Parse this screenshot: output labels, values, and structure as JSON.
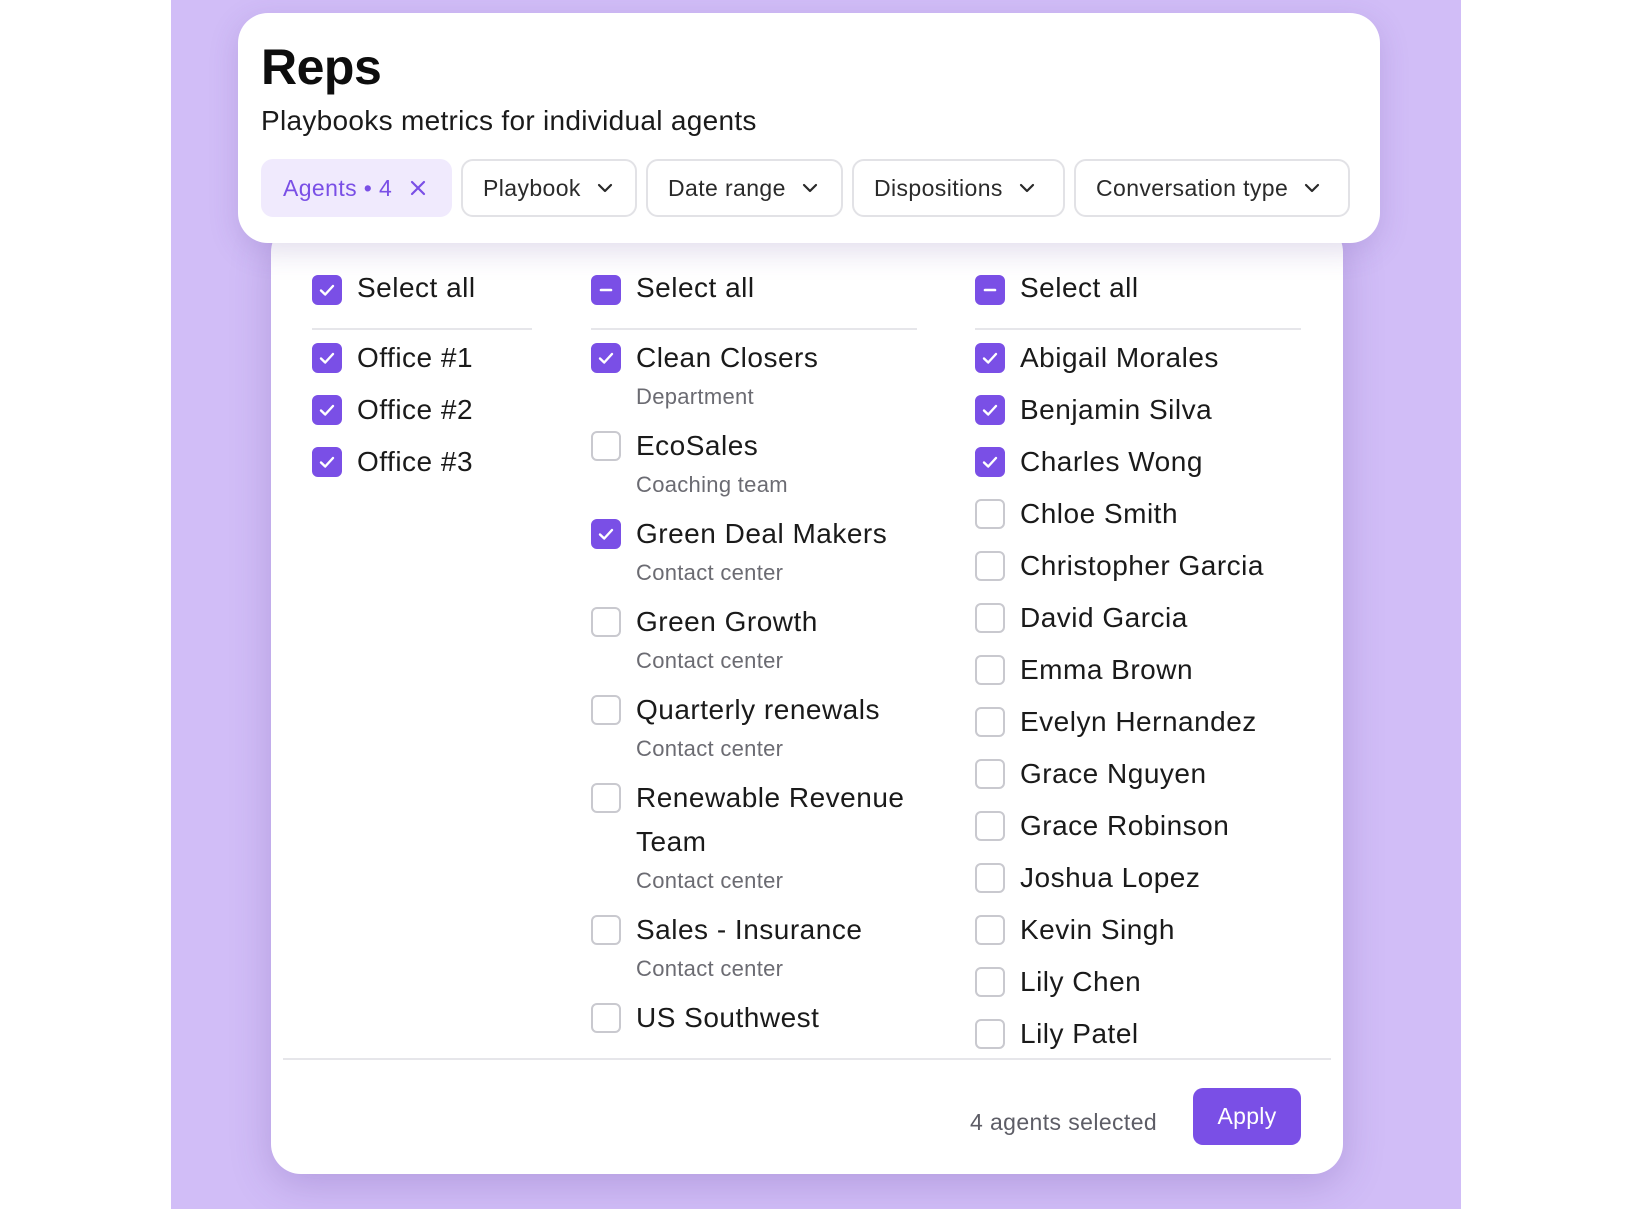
{
  "header": {
    "title": "Reps",
    "subtitle": "Playbooks metrics for individual agents",
    "filters": {
      "agents_label": "Agents • 4",
      "playbook_label": "Playbook",
      "date_range_label": "Date range",
      "dispositions_label": "Dispositions",
      "conversation_type_label": "Conversation type"
    }
  },
  "colors": {
    "accent": "#7a4fe6",
    "background": "#d1bdf7"
  },
  "offices": {
    "select_all": {
      "label": "Select all",
      "state": "checked"
    },
    "items": [
      {
        "label": "Office #1",
        "checked": true
      },
      {
        "label": "Office #2",
        "checked": true
      },
      {
        "label": "Office #3",
        "checked": true
      }
    ]
  },
  "teams": {
    "select_all": {
      "label": "Select all",
      "state": "partial"
    },
    "items": [
      {
        "label": "Clean Closers",
        "sub": "Department",
        "checked": true
      },
      {
        "label": "EcoSales",
        "sub": "Coaching team",
        "checked": false
      },
      {
        "label": "Green Deal Makers",
        "sub": "Contact center",
        "checked": true
      },
      {
        "label": "Green Growth",
        "sub": "Contact center",
        "checked": false
      },
      {
        "label": "Quarterly renewals",
        "sub": "Contact center",
        "checked": false
      },
      {
        "label": "Renewable Revenue Team",
        "sub": "Contact center",
        "checked": false
      },
      {
        "label": "Sales - Insurance",
        "sub": "Contact center",
        "checked": false
      },
      {
        "label": "US Southwest",
        "sub": "",
        "checked": false
      }
    ]
  },
  "agents": {
    "select_all": {
      "label": "Select all",
      "state": "partial"
    },
    "items": [
      {
        "label": "Abigail Morales",
        "checked": true
      },
      {
        "label": "Benjamin Silva",
        "checked": true
      },
      {
        "label": "Charles Wong",
        "checked": true
      },
      {
        "label": "Chloe Smith",
        "checked": false
      },
      {
        "label": "Christopher Garcia",
        "checked": false
      },
      {
        "label": "David Garcia",
        "checked": false
      },
      {
        "label": "Emma Brown",
        "checked": false
      },
      {
        "label": "Evelyn Hernandez",
        "checked": false
      },
      {
        "label": "Grace Nguyen",
        "checked": false
      },
      {
        "label": "Grace Robinson",
        "checked": false
      },
      {
        "label": "Joshua Lopez",
        "checked": false
      },
      {
        "label": "Kevin Singh",
        "checked": false
      },
      {
        "label": "Lily Chen",
        "checked": false
      },
      {
        "label": "Lily Patel",
        "checked": false
      }
    ]
  },
  "footer": {
    "selected_text": "4 agents selected",
    "apply_label": "Apply"
  }
}
